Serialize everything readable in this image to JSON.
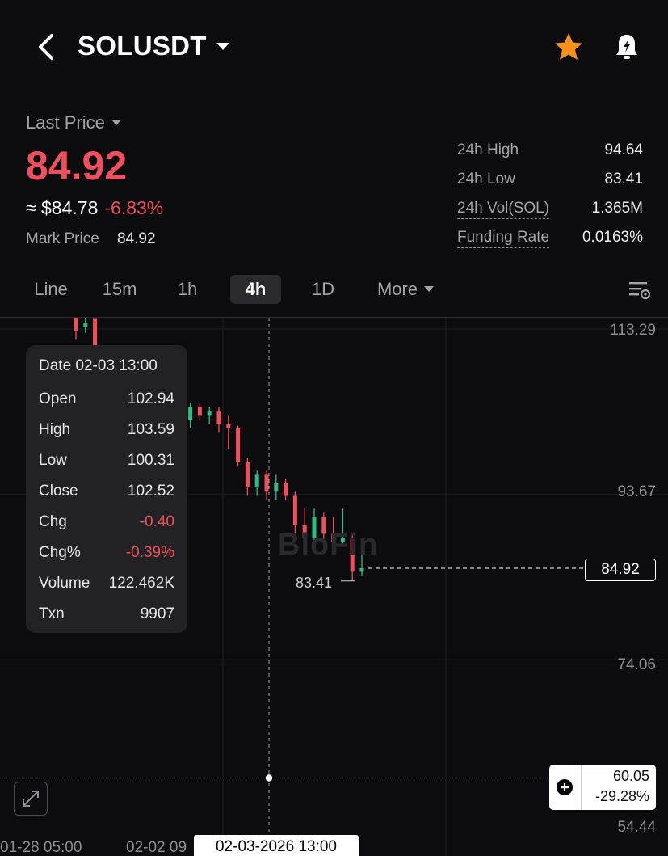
{
  "header": {
    "pair": "SOLUSDT"
  },
  "price": {
    "last_price_label": "Last Price",
    "last_price": "84.92",
    "approx_usd": "≈ $84.78",
    "change_pct": "-6.83%",
    "mark_price_label": "Mark Price",
    "mark_price": "84.92"
  },
  "stats": [
    {
      "label": "24h High",
      "value": "94.64"
    },
    {
      "label": "24h Low",
      "value": "83.41"
    },
    {
      "label": "24h Vol(SOL)",
      "value": "1.365M"
    },
    {
      "label": "Funding Rate",
      "value": "0.0163%"
    }
  ],
  "tabs": [
    "Line",
    "15m",
    "1h",
    "4h",
    "1D",
    "More"
  ],
  "active_tab": "4h",
  "chart": {
    "watermark": "BloFin",
    "price_labels": [
      "113.29",
      "93.67",
      "74.06",
      "54.44"
    ],
    "current_price": "84.92",
    "low_marker": "83.41",
    "crosshair_price": "60.05",
    "crosshair_pct": "-29.28%",
    "time_labels": [
      "01-28 05:00",
      "02-02 09"
    ],
    "crosshair_time": "02-03-2026 13:00",
    "colors": {
      "up": "#2ebd85",
      "down": "#ef4f5e",
      "accent_star": "#f7931a"
    }
  },
  "tooltip": {
    "date": "Date 02-03 13:00",
    "rows": [
      {
        "k": "Open",
        "v": "102.94"
      },
      {
        "k": "High",
        "v": "103.59"
      },
      {
        "k": "Low",
        "v": "100.31"
      },
      {
        "k": "Close",
        "v": "102.52"
      },
      {
        "k": "Chg",
        "v": "-0.40"
      },
      {
        "k": "Chg%",
        "v": "-0.39%"
      },
      {
        "k": "Volume",
        "v": "122.462K"
      },
      {
        "k": "Txn",
        "v": "9907"
      }
    ]
  },
  "chart_data": {
    "type": "candlestick",
    "interval": "4h",
    "ylim": [
      54.44,
      113.29
    ],
    "y_ticks": [
      113.29,
      93.67,
      74.06,
      54.44
    ],
    "x_ticks": [
      "01-28 05:00",
      "02-02 09"
    ],
    "candles": [
      {
        "o": 117.0,
        "h": 118.5,
        "l": 112.0,
        "c": 113.0
      },
      {
        "o": 113.5,
        "h": 115.0,
        "l": 112.8,
        "c": 114.0
      },
      {
        "o": 114.5,
        "h": 115.5,
        "l": 100.5,
        "c": 101.5
      },
      {
        "o": 101.0,
        "h": 103.5,
        "l": 97.0,
        "c": 102.5
      },
      {
        "o": 102.5,
        "h": 105.0,
        "l": 101.0,
        "c": 104.0
      },
      {
        "o": 104.0,
        "h": 104.5,
        "l": 96.5,
        "c": 97.0
      },
      {
        "o": 97.0,
        "h": 101.0,
        "l": 92.0,
        "c": 96.0
      },
      {
        "o": 96.0,
        "h": 100.5,
        "l": 95.5,
        "c": 100.0
      },
      {
        "o": 100.0,
        "h": 101.5,
        "l": 99.0,
        "c": 101.0
      },
      {
        "o": 101.0,
        "h": 104.5,
        "l": 100.5,
        "c": 104.0
      },
      {
        "o": 104.0,
        "h": 105.5,
        "l": 102.0,
        "c": 103.0
      },
      {
        "o": 103.0,
        "h": 104.5,
        "l": 101.5,
        "c": 102.5
      },
      {
        "o": 102.5,
        "h": 104.5,
        "l": 101.5,
        "c": 104.0
      },
      {
        "o": 104.0,
        "h": 104.5,
        "l": 102.5,
        "c": 103.0
      },
      {
        "o": 103.0,
        "h": 104.0,
        "l": 102.0,
        "c": 103.5
      },
      {
        "o": 103.5,
        "h": 104.0,
        "l": 101.0,
        "c": 102.0
      },
      {
        "o": 102.0,
        "h": 103.0,
        "l": 99.0,
        "c": 101.5
      },
      {
        "o": 101.5,
        "h": 101.8,
        "l": 97.0,
        "c": 97.5
      },
      {
        "o": 97.5,
        "h": 98.0,
        "l": 93.5,
        "c": 94.5
      },
      {
        "o": 94.5,
        "h": 96.5,
        "l": 93.5,
        "c": 96.0
      },
      {
        "o": 96.0,
        "h": 96.5,
        "l": 93.0,
        "c": 94.0
      },
      {
        "o": 94.0,
        "h": 96.0,
        "l": 93.0,
        "c": 95.0
      },
      {
        "o": 95.0,
        "h": 95.5,
        "l": 93.0,
        "c": 93.5
      },
      {
        "o": 93.5,
        "h": 94.0,
        "l": 89.0,
        "c": 90.0
      },
      {
        "o": 90.0,
        "h": 92.0,
        "l": 88.0,
        "c": 88.5
      },
      {
        "o": 88.5,
        "h": 92.0,
        "l": 87.5,
        "c": 91.0
      },
      {
        "o": 91.0,
        "h": 91.5,
        "l": 88.0,
        "c": 89.0
      },
      {
        "o": 89.0,
        "h": 91.0,
        "l": 87.0,
        "c": 88.0
      },
      {
        "o": 88.0,
        "h": 92.0,
        "l": 87.5,
        "c": 88.5
      },
      {
        "o": 88.5,
        "h": 89.0,
        "l": 83.41,
        "c": 84.5
      },
      {
        "o": 84.5,
        "h": 86.5,
        "l": 84.0,
        "c": 84.92
      }
    ]
  }
}
